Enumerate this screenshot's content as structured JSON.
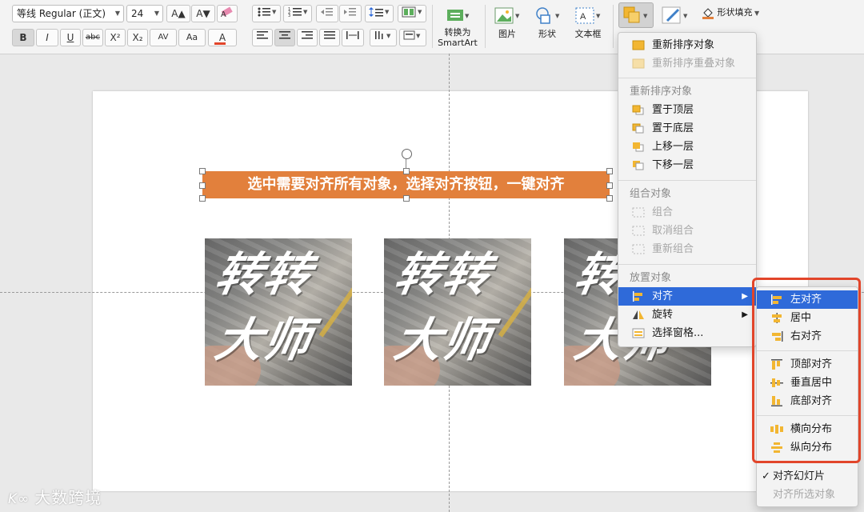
{
  "ribbon": {
    "font_name": "等线 Regular (正文)",
    "font_size": "24",
    "grow_font": "A▲",
    "shrink_font": "A▼",
    "bold": "B",
    "italic": "I",
    "underline": "U",
    "strikethrough": "abc",
    "superscript": "X²",
    "subscript": "X₂",
    "char_spacing": "AV",
    "change_case": "Aa",
    "font_color": "A",
    "convert_smartart": "转换为\nSmartArt",
    "picture": "图片",
    "shape": "形状",
    "textbox": "文本框",
    "shape_fill": "形状填充"
  },
  "slide": {
    "title_text": "选中需要对齐所有对象，选择对齐按钮，一键对齐",
    "tile_line1": "转转",
    "tile_line2": "大师"
  },
  "arrange_menu": {
    "reorder_objects": "重新排序对象",
    "reorder_overlapping": "重新排序重叠对象",
    "section_reorder": "重新排序对象",
    "bring_to_front": "置于顶层",
    "send_to_back": "置于底层",
    "bring_forward": "上移一层",
    "send_backward": "下移一层",
    "section_group": "组合对象",
    "group": "组合",
    "ungroup": "取消组合",
    "regroup": "重新组合",
    "section_position": "放置对象",
    "align": "对齐",
    "rotate": "旋转",
    "selection_pane": "选择窗格..."
  },
  "align_menu": {
    "align_left": "左对齐",
    "align_center": "居中",
    "align_right": "右对齐",
    "align_top": "顶部对齐",
    "align_middle": "垂直居中",
    "align_bottom": "底部对齐",
    "distribute_horizontally": "横向分布",
    "distribute_vertically": "纵向分布",
    "align_to_slide": "对齐幻灯片",
    "align_selected": "对齐所选对象",
    "check_mark": "✓"
  },
  "watermark": {
    "logo": "K∞",
    "text": "大数跨境"
  },
  "colors": {
    "accent_orange": "#e2803c",
    "menu_highlight": "#2f6ad9",
    "callout_red": "#e2452a",
    "icon_yellow": "#f2b632"
  }
}
